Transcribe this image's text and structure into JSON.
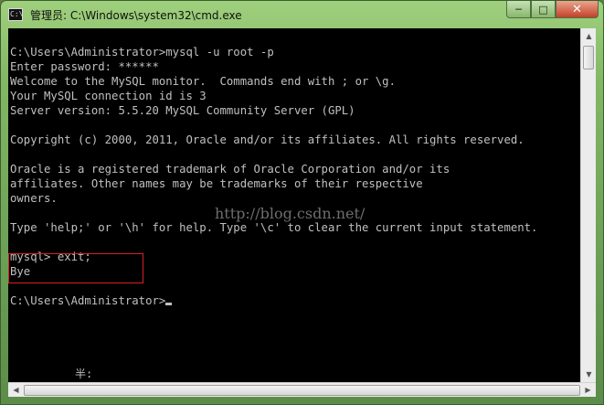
{
  "window": {
    "title": "管理员: C:\\Windows\\system32\\cmd.exe",
    "icon": "C:\\"
  },
  "titlebar_buttons": {
    "minimize": "─",
    "maximize": "□",
    "close": "✕"
  },
  "console": {
    "lines": [
      "C:\\Users\\Administrator>mysql -u root -p",
      "Enter password: ******",
      "Welcome to the MySQL monitor.  Commands end with ; or \\g.",
      "Your MySQL connection id is 3",
      "Server version: 5.5.20 MySQL Community Server (GPL)",
      "",
      "Copyright (c) 2000, 2011, Oracle and/or its affiliates. All rights reserved.",
      "",
      "Oracle is a registered trademark of Oracle Corporation and/or its",
      "affiliates. Other names may be trademarks of their respective",
      "owners.",
      "",
      "Type 'help;' or '\\h' for help. Type '\\c' to clear the current input statement.",
      "",
      "mysql> exit;",
      "Bye",
      "",
      "C:\\Users\\Administrator>"
    ],
    "ime_indicator": "半:"
  },
  "watermark": "http://blog.csdn.net/",
  "scrollbar": {
    "up": "▲",
    "down": "▼",
    "left": "◀",
    "right": "▶"
  }
}
